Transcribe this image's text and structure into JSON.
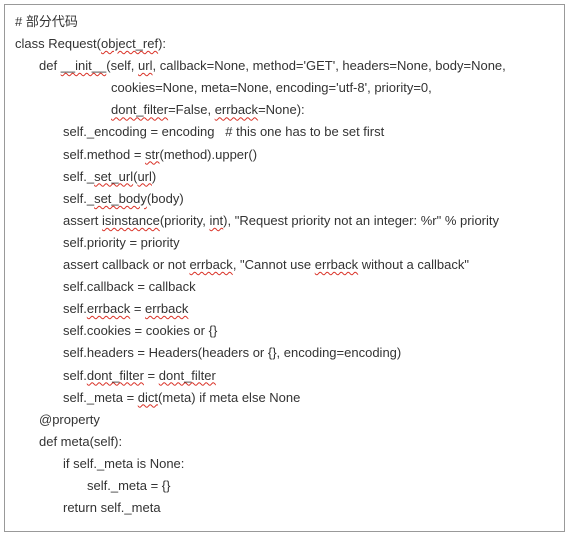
{
  "code": {
    "comment": "# 部分代码",
    "lines": [
      {
        "indent": "",
        "segs": [
          {
            "t": "class Request(",
            "e": false
          },
          {
            "t": "object_ref",
            "e": true
          },
          {
            "t": "):",
            "e": false
          }
        ]
      },
      {
        "indent": "i1",
        "segs": [
          {
            "t": "def ",
            "e": false
          },
          {
            "t": "__init__",
            "e": true
          },
          {
            "t": "(self, ",
            "e": false
          },
          {
            "t": "url",
            "e": true
          },
          {
            "t": ", callback=None, method='GET', headers=None, body=None,",
            "e": false
          }
        ]
      },
      {
        "indent": "i3",
        "segs": [
          {
            "t": "cookies=None, meta=None, encoding='utf-8', priority=0,",
            "e": false
          }
        ]
      },
      {
        "indent": "i3",
        "segs": [
          {
            "t": "dont_filter",
            "e": true
          },
          {
            "t": "=False, ",
            "e": false
          },
          {
            "t": "errback",
            "e": true
          },
          {
            "t": "=None):",
            "e": false
          }
        ]
      },
      {
        "indent": "i2",
        "segs": [
          {
            "t": "self._encoding = encoding   # this one has to be set first",
            "e": false
          }
        ]
      },
      {
        "indent": "i2",
        "segs": [
          {
            "t": "self.method = ",
            "e": false
          },
          {
            "t": "str",
            "e": true
          },
          {
            "t": "(method).upper()",
            "e": false
          }
        ]
      },
      {
        "indent": "i2",
        "segs": [
          {
            "t": "self._",
            "e": false
          },
          {
            "t": "set_url",
            "e": true
          },
          {
            "t": "(",
            "e": false
          },
          {
            "t": "url",
            "e": true
          },
          {
            "t": ")",
            "e": false
          }
        ]
      },
      {
        "indent": "i2",
        "segs": [
          {
            "t": "self._",
            "e": false
          },
          {
            "t": "set_body",
            "e": true
          },
          {
            "t": "(body)",
            "e": false
          }
        ]
      },
      {
        "indent": "i2",
        "segs": [
          {
            "t": "assert ",
            "e": false
          },
          {
            "t": "isinstance",
            "e": true
          },
          {
            "t": "(priority, ",
            "e": false
          },
          {
            "t": "int",
            "e": true
          },
          {
            "t": "), \"Request priority not an integer: %r\" % priority",
            "e": false
          }
        ]
      },
      {
        "indent": "i2",
        "segs": [
          {
            "t": "self.priority = priority",
            "e": false
          }
        ]
      },
      {
        "indent": "i2",
        "segs": [
          {
            "t": "assert callback or not ",
            "e": false
          },
          {
            "t": "errback",
            "e": true
          },
          {
            "t": ", \"Cannot use ",
            "e": false
          },
          {
            "t": "errback",
            "e": true
          },
          {
            "t": " without a callback\"",
            "e": false
          }
        ]
      },
      {
        "indent": "i2",
        "segs": [
          {
            "t": "self.callback = callback",
            "e": false
          }
        ]
      },
      {
        "indent": "i2",
        "segs": [
          {
            "t": "self.",
            "e": false
          },
          {
            "t": "errback",
            "e": true
          },
          {
            "t": " = ",
            "e": false
          },
          {
            "t": "errback",
            "e": true
          }
        ]
      },
      {
        "indent": "i2",
        "segs": [
          {
            "t": "self.cookies = cookies or {}",
            "e": false
          }
        ]
      },
      {
        "indent": "i2",
        "segs": [
          {
            "t": "self.headers = Headers(headers or {}, encoding=encoding)",
            "e": false
          }
        ]
      },
      {
        "indent": "i2",
        "segs": [
          {
            "t": "self.",
            "e": false
          },
          {
            "t": "dont_filter",
            "e": true
          },
          {
            "t": " = ",
            "e": false
          },
          {
            "t": "dont_filter",
            "e": true
          }
        ]
      },
      {
        "indent": "i2",
        "segs": [
          {
            "t": "self._meta = ",
            "e": false
          },
          {
            "t": "dict",
            "e": true
          },
          {
            "t": "(meta) if meta else None",
            "e": false
          }
        ]
      },
      {
        "indent": "i1",
        "segs": [
          {
            "t": "@property",
            "e": false
          }
        ]
      },
      {
        "indent": "i1",
        "segs": [
          {
            "t": "def meta(self):",
            "e": false
          }
        ]
      },
      {
        "indent": "i2",
        "segs": [
          {
            "t": "if self._meta is None:",
            "e": false
          }
        ]
      },
      {
        "indent": "i4",
        "segs": [
          {
            "t": "self._meta = {}",
            "e": false
          }
        ]
      },
      {
        "indent": "i2",
        "segs": [
          {
            "t": "return self._meta",
            "e": false
          }
        ]
      }
    ]
  }
}
